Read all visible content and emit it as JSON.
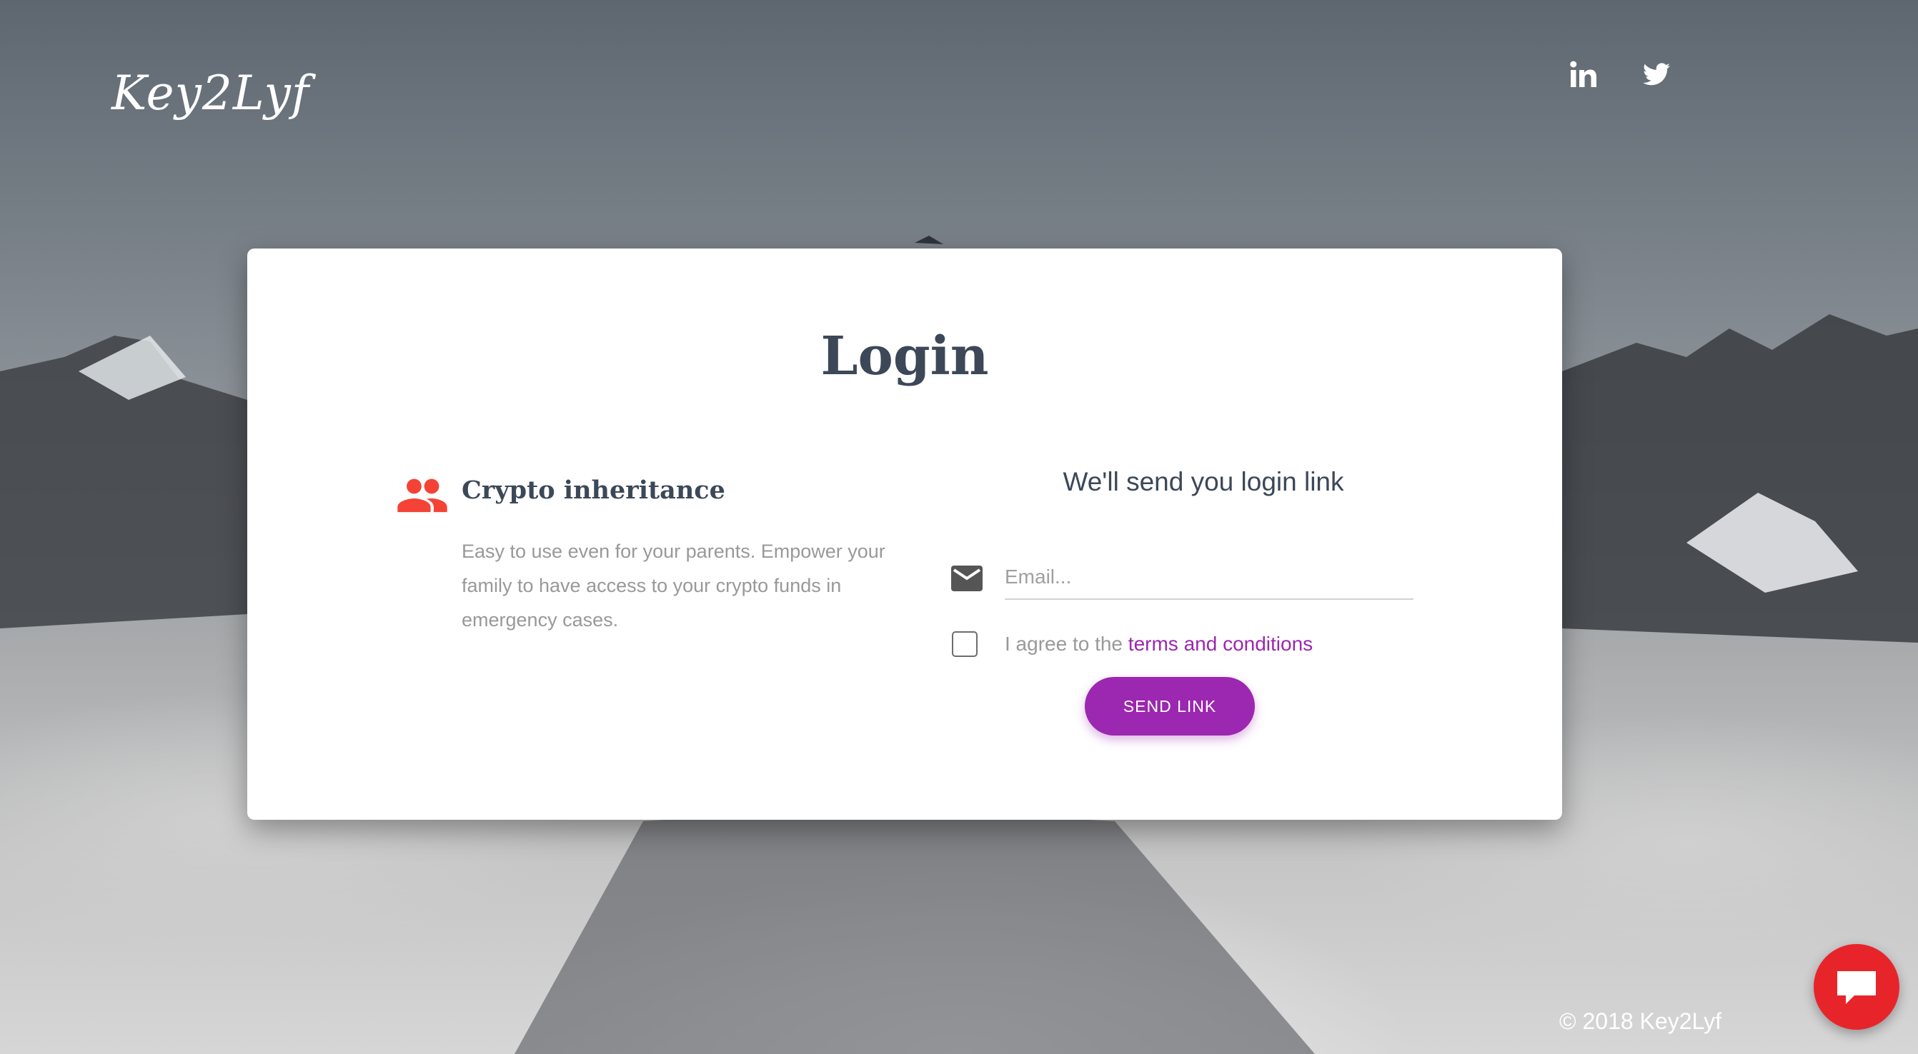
{
  "header": {
    "brand": "Key2Lyf",
    "social": [
      {
        "icon": "linkedin-icon"
      },
      {
        "icon": "twitter-icon"
      }
    ]
  },
  "login_card": {
    "title": "Login",
    "feature": {
      "icon": "people-icon",
      "title": "Crypto inheritance",
      "description": "Easy to use even for your parents. Empower your family to have access to your crypto funds in emergency cases."
    },
    "form": {
      "heading": "We'll send you login link",
      "email_icon": "mail-icon",
      "email_placeholder": "Email...",
      "email_value": "",
      "agree_prefix": "I agree to the ",
      "terms_label": "terms and conditions",
      "agree_checked": false,
      "submit_label": "SEND LINK"
    }
  },
  "footer": {
    "copyright": "© 2018 Key2Lyf"
  },
  "chat_widget": {
    "icon": "chat-icon"
  },
  "colors": {
    "accent": "#9c27b0",
    "feature_icon": "#f44336",
    "chat_button": "#e8242b",
    "heading_text": "#3c4858"
  }
}
